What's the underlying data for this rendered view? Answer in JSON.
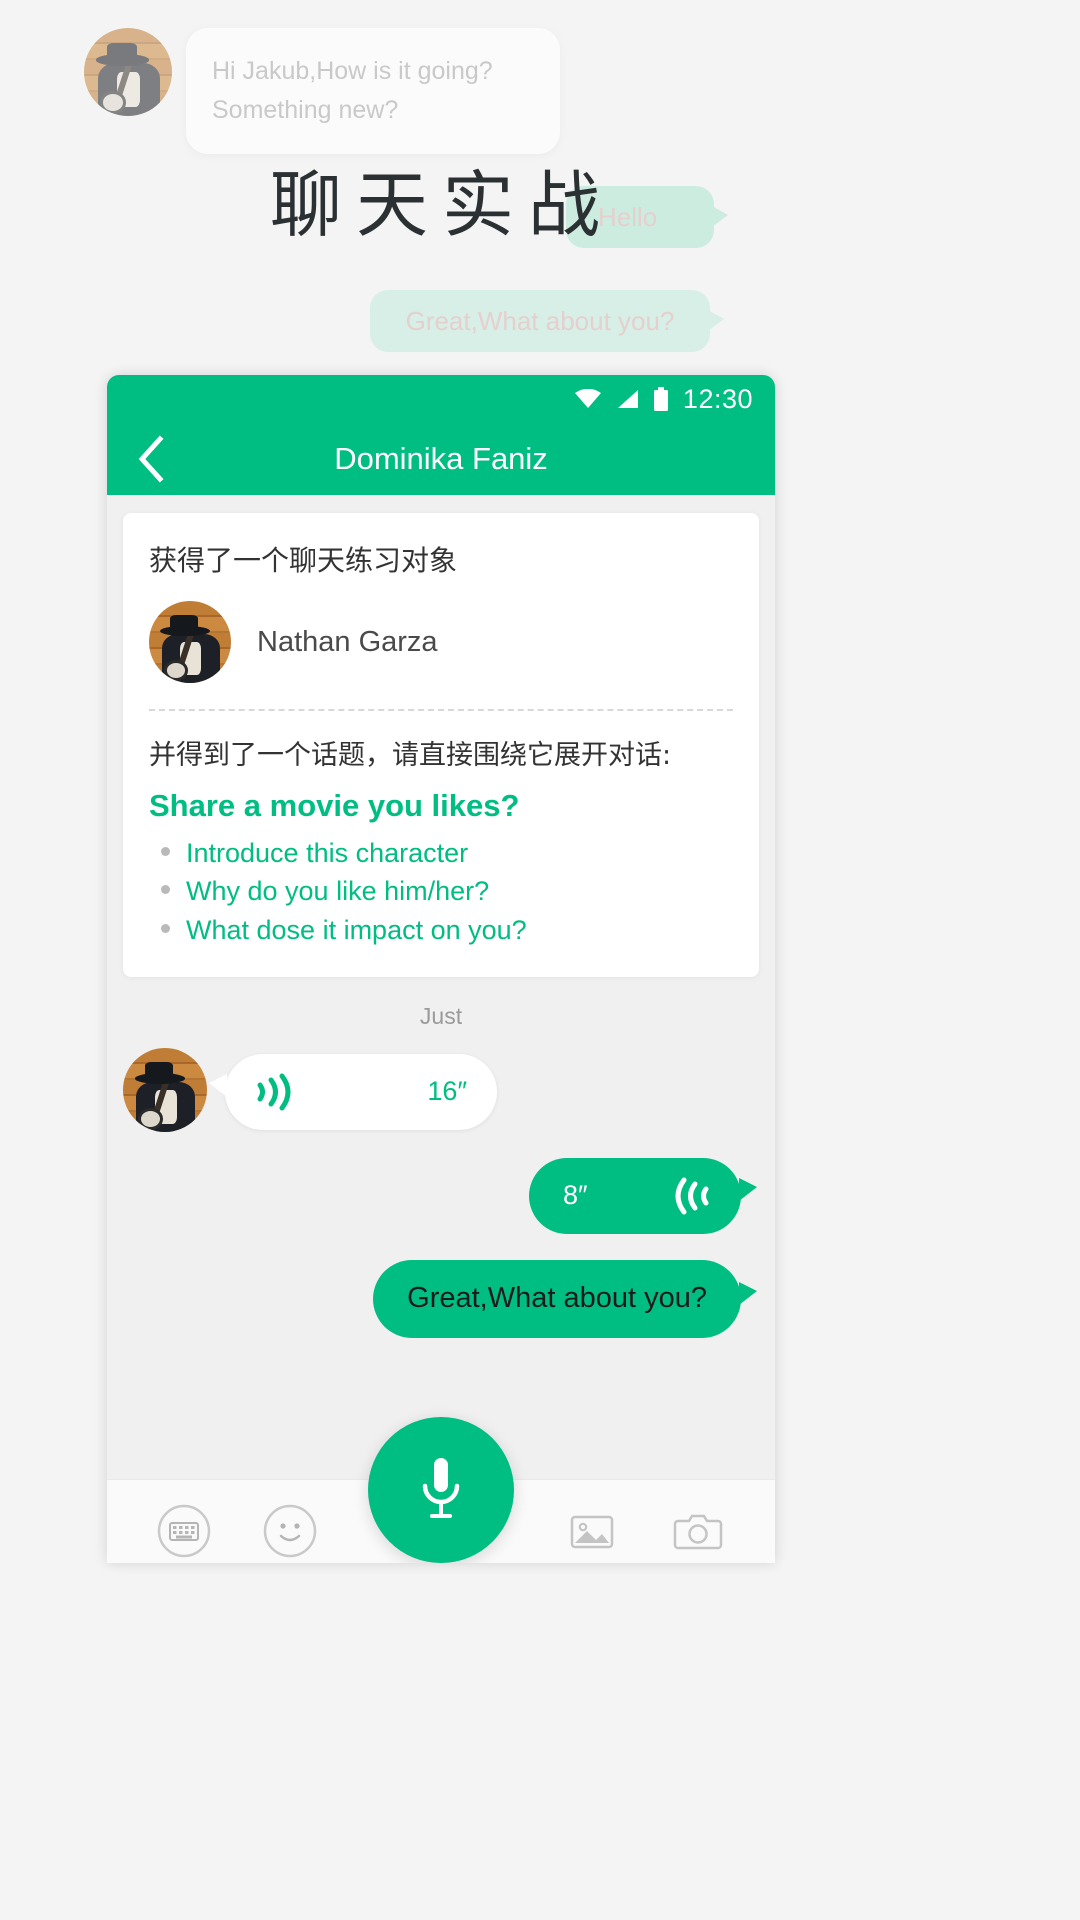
{
  "promo": {
    "title": "聊天实战",
    "incoming_bubble": {
      "line1": "Hi Jakub,How is it going?",
      "line2": "Something new?"
    },
    "outgoing_bubble_1": "Hello",
    "outgoing_bubble_2": "Great,What about you?"
  },
  "statusbar": {
    "time": "12:30",
    "wifi_icon": "wifi-icon",
    "signal_icon": "signal-icon",
    "battery_icon": "battery-icon"
  },
  "appbar": {
    "back_icon": "back-chevron-icon",
    "title": "Dominika Faniz"
  },
  "card": {
    "title": "获得了一个聊天练习对象",
    "partner_name": "Nathan Garza",
    "partner_avatar": "user-avatar",
    "subtitle": "并得到了一个话题，请直接围绕它展开对话:",
    "topic": "Share a movie you likes?",
    "bullets": [
      "Introduce this character",
      "Why do you like him/her?",
      "What dose it impact on you?"
    ]
  },
  "messages": {
    "timestamp": "Just",
    "incoming_voice": {
      "duration": "16″",
      "icon": "sound-wave-icon"
    },
    "outgoing_voice": {
      "duration": "8″",
      "icon": "sound-wave-icon"
    },
    "outgoing_text": "Great,What about you?"
  },
  "toolbar": {
    "keyboard_icon": "keyboard-icon",
    "emoji_icon": "emoji-icon",
    "mic_icon": "microphone-icon",
    "gallery_icon": "gallery-icon",
    "camera_icon": "camera-icon"
  },
  "colors": {
    "brand_green": "#00bd82",
    "page_bg": "#f4f4f4",
    "chat_bg": "#f0f0f0"
  }
}
